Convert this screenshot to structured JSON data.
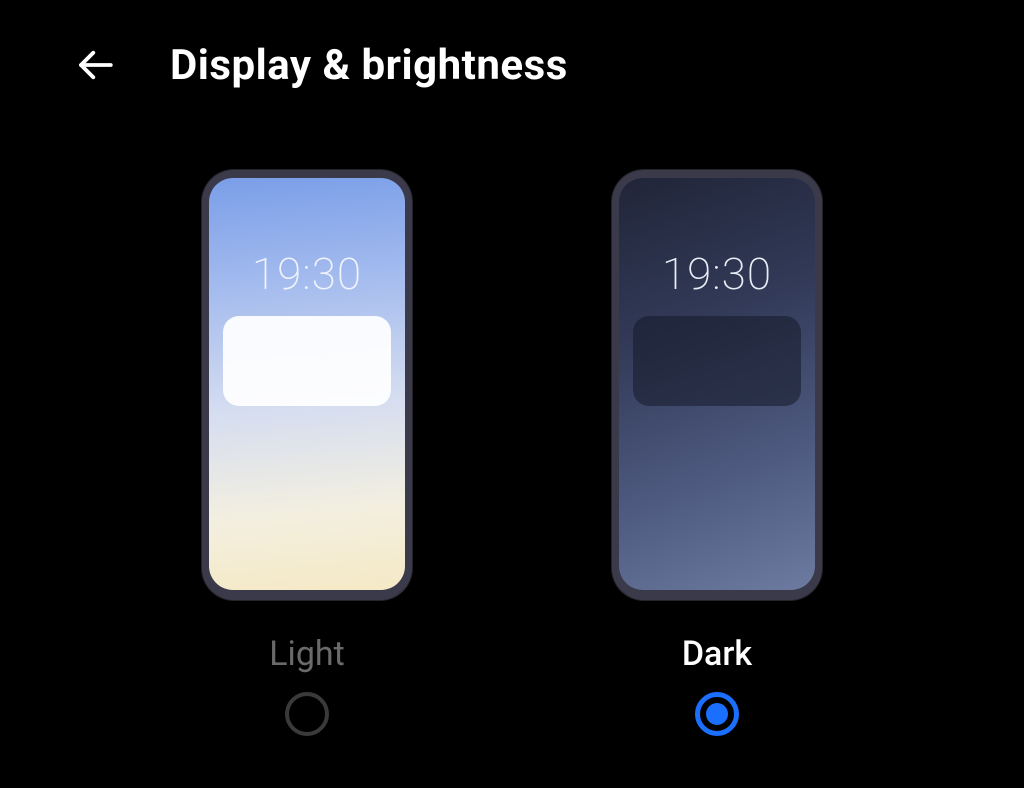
{
  "header": {
    "title": "Display & brightness"
  },
  "themes": {
    "light": {
      "label": "Light",
      "clock": "19:30",
      "selected": false
    },
    "dark": {
      "label": "Dark",
      "clock": "19:30",
      "selected": true
    }
  },
  "colors": {
    "accent": "#1b6fff",
    "background": "#000000"
  }
}
